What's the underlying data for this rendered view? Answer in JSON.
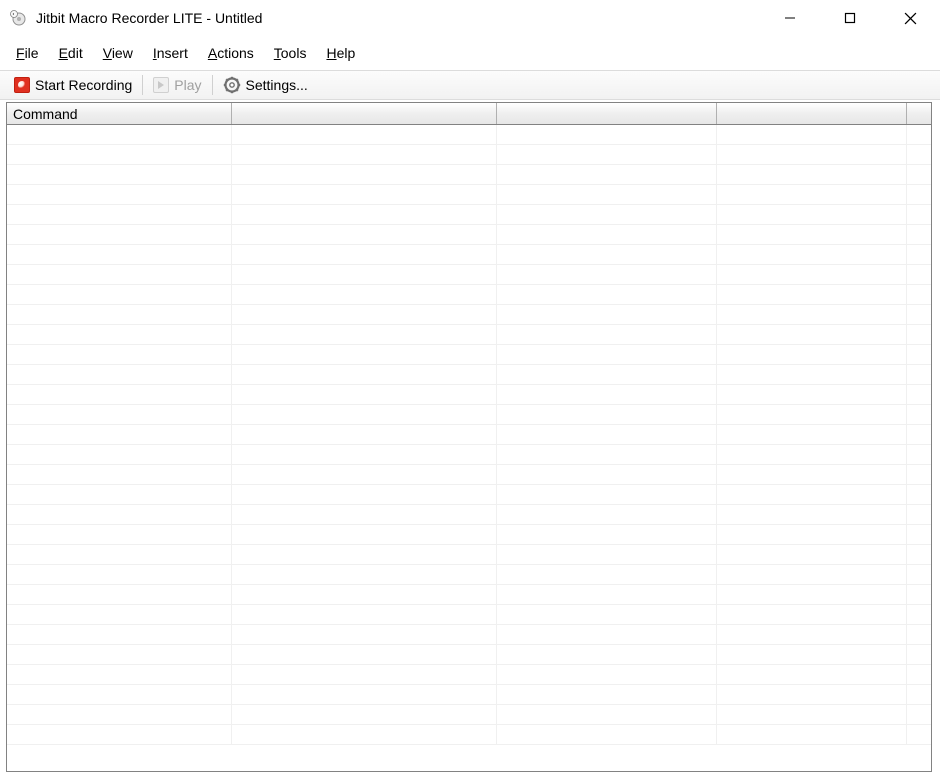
{
  "window": {
    "title": "Jitbit Macro Recorder LITE - Untitled"
  },
  "menubar": {
    "items": [
      {
        "label": "File",
        "accel_index": 0
      },
      {
        "label": "Edit",
        "accel_index": 0
      },
      {
        "label": "View",
        "accel_index": 0
      },
      {
        "label": "Insert",
        "accel_index": 0
      },
      {
        "label": "Actions",
        "accel_index": 0
      },
      {
        "label": "Tools",
        "accel_index": 0
      },
      {
        "label": "Help",
        "accel_index": 0
      }
    ]
  },
  "toolbar": {
    "start_label": "Start Recording",
    "play_label": "Play",
    "settings_label": "Settings..."
  },
  "grid": {
    "columns": [
      "Command",
      "",
      "",
      "",
      ""
    ],
    "rows": 31
  }
}
